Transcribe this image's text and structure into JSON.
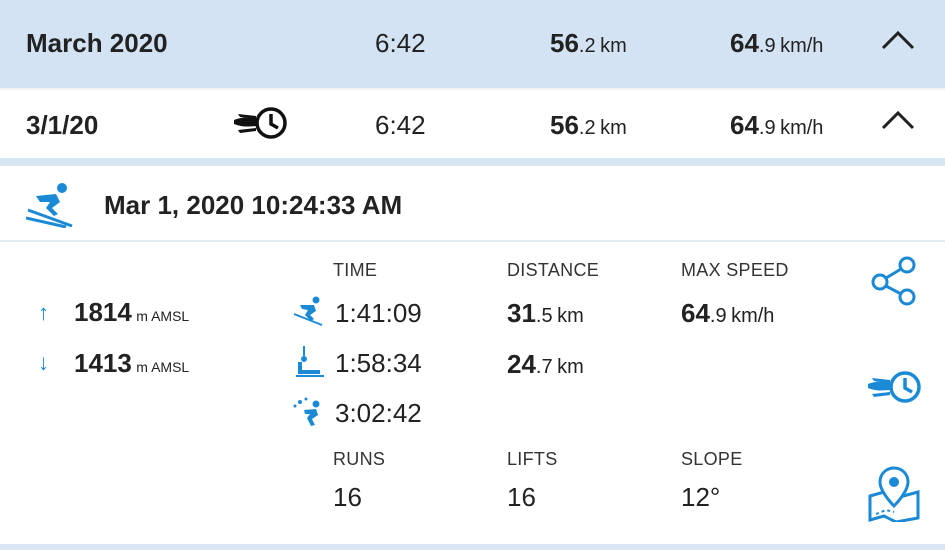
{
  "month_row": {
    "label": "March 2020",
    "time": "6:42",
    "distance_int": "56",
    "distance_dec": ".2",
    "distance_unit": "km",
    "speed_int": "64",
    "speed_dec": ".9",
    "speed_unit": "km/h"
  },
  "day_row": {
    "label": "3/1/20",
    "time": "6:42",
    "distance_int": "56",
    "distance_dec": ".2",
    "distance_unit": "km",
    "speed_int": "64",
    "speed_dec": ".9",
    "speed_unit": "km/h"
  },
  "session": {
    "datetime": "Mar 1, 2020 10:24:33 AM",
    "altitude_up": "1814",
    "altitude_down": "1413",
    "altitude_unit": "m AMSL",
    "headers": {
      "time": "TIME",
      "distance": "DISTANCE",
      "max_speed": "MAX SPEED",
      "runs": "RUNS",
      "lifts": "LIFTS",
      "slope": "SLOPE"
    },
    "ski_time": "1:41:09",
    "lift_time": "1:58:34",
    "total_time": "3:02:42",
    "ski_distance_int": "31",
    "ski_distance_dec": ".5",
    "lift_distance_int": "24",
    "lift_distance_dec": ".7",
    "distance_unit": "km",
    "max_speed_int": "64",
    "max_speed_dec": ".9",
    "max_speed_unit": "km/h",
    "runs": "16",
    "lifts": "16",
    "slope": "12°"
  },
  "icons": {
    "accent_color": "#1a8ad6",
    "month_collapse": "chevron-up-icon",
    "day_collapse": "chevron-up-icon",
    "fast_clock": "fast-clock-icon",
    "skier": "skier-icon",
    "share": "share-icon",
    "replay": "fast-clock-icon",
    "map": "map-pin-icon"
  }
}
